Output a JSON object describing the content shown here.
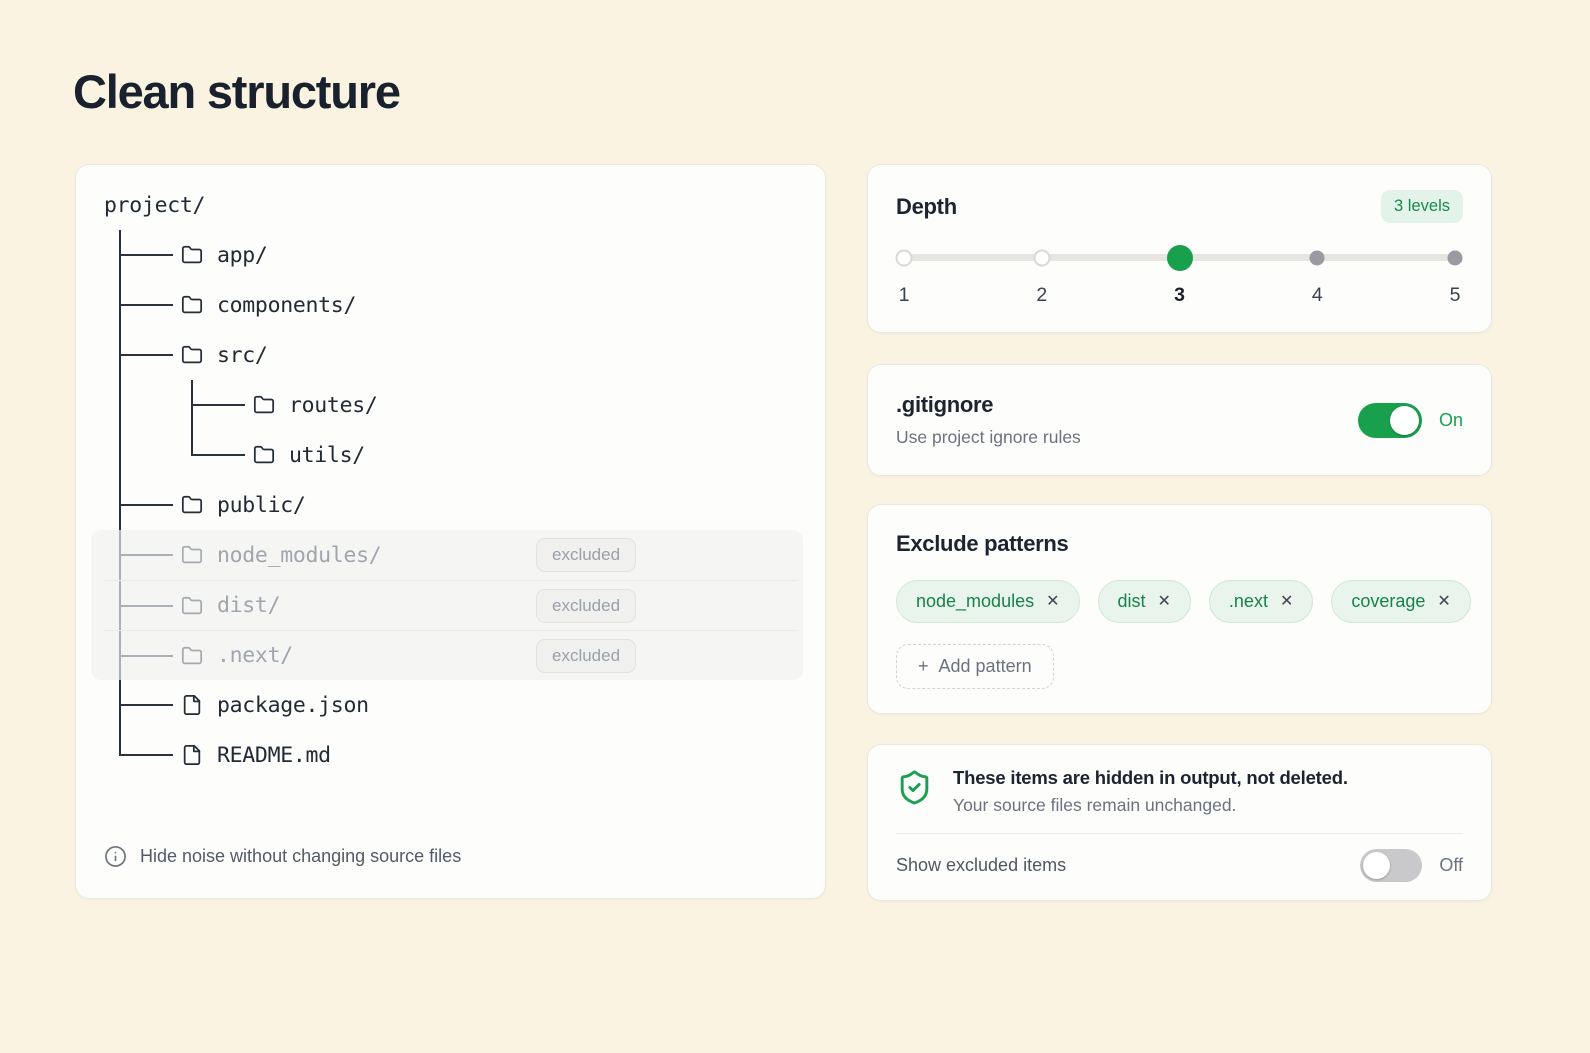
{
  "page": {
    "title": "Clean structure"
  },
  "colors": {
    "background": "#faf3e1",
    "accent_green": "#18a04d",
    "chip_bg": "#e9f5ec",
    "chip_text": "#17824a",
    "excluded_gray": "#9fa6ae"
  },
  "tree": {
    "excluded_badge": "excluded",
    "footer": "Hide noise without changing source files",
    "rows": [
      {
        "label": "project/",
        "depth": 0,
        "type": "root"
      },
      {
        "label": "app/",
        "depth": 1,
        "conn": "tee",
        "icon": "folder",
        "excluded": false
      },
      {
        "label": "components/",
        "depth": 1,
        "conn": "tee",
        "icon": "folder",
        "excluded": false
      },
      {
        "label": "src/",
        "depth": 1,
        "conn": "tee",
        "icon": "folder",
        "excluded": false
      },
      {
        "label": "routes/",
        "depth": 2,
        "conn": "tee",
        "icon": "folder",
        "excluded": false
      },
      {
        "label": "utils/",
        "depth": 2,
        "conn": "elbow",
        "icon": "folder",
        "excluded": false
      },
      {
        "label": "public/",
        "depth": 1,
        "conn": "tee",
        "icon": "folder",
        "excluded": false
      },
      {
        "label": "node_modules/",
        "depth": 1,
        "conn": "tee",
        "icon": "folder",
        "excluded": true
      },
      {
        "label": "dist/",
        "depth": 1,
        "conn": "tee",
        "icon": "folder",
        "excluded": true
      },
      {
        "label": ".next/",
        "depth": 1,
        "conn": "tee",
        "icon": "folder",
        "excluded": true
      },
      {
        "label": "package.json",
        "depth": 1,
        "conn": "tee",
        "icon": "file",
        "excluded": false
      },
      {
        "label": "README.md",
        "depth": 1,
        "conn": "elbow",
        "icon": "file",
        "excluded": false
      }
    ]
  },
  "depth": {
    "title": "Depth",
    "badge": "3 levels",
    "value": 3,
    "stops": [
      {
        "label": "1",
        "state": "empty"
      },
      {
        "label": "2",
        "state": "empty"
      },
      {
        "label": "3",
        "state": "active"
      },
      {
        "label": "4",
        "state": "filled"
      },
      {
        "label": "5",
        "state": "filled"
      }
    ]
  },
  "gitignore": {
    "title": ".gitignore",
    "subtitle": "Use project ignore rules",
    "toggle_state": "on",
    "state_label": "On"
  },
  "exclude": {
    "title": "Exclude patterns",
    "patterns": [
      "node_modules",
      "dist",
      ".next",
      "coverage"
    ],
    "remove_glyph": "✕",
    "add_plus": "+",
    "add_label": "Add pattern"
  },
  "notice": {
    "line1": "These items are hidden in output, not deleted.",
    "line2": "Your source files remain unchanged.",
    "row_label": "Show excluded items",
    "toggle_state": "off",
    "state_label": "Off"
  }
}
